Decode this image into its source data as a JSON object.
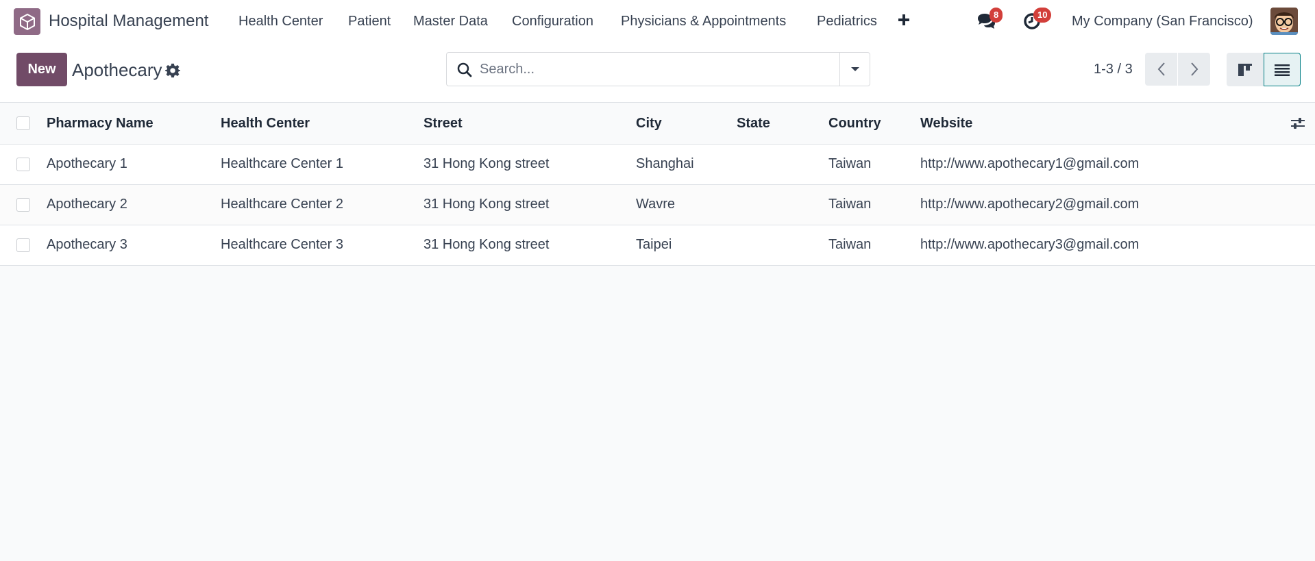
{
  "navbar": {
    "app_title": "Hospital Management",
    "menu": [
      "Health Center",
      "Patient",
      "Master Data",
      "Configuration",
      "Physicians & Appointments",
      "Pediatrics"
    ],
    "messages_count": "8",
    "activities_count": "10",
    "company": "My Company (San Francisco)",
    "icons": {
      "logo": "app-cube-icon",
      "add": "plus-icon",
      "messages": "chat-icon",
      "activities": "clock-icon"
    },
    "colors": {
      "brand": "#714b67",
      "badge": "#d23f3a"
    }
  },
  "control_panel": {
    "new_label": "New",
    "title": "Apothecary",
    "search_placeholder": "Search...",
    "pager": "1-3 / 3"
  },
  "table": {
    "columns": [
      "Pharmacy Name",
      "Health Center",
      "Street",
      "City",
      "State",
      "Country",
      "Website"
    ],
    "rows": [
      [
        "Apothecary 1",
        "Healthcare Center 1",
        "31 Hong Kong street",
        "Shanghai",
        "",
        "Taiwan",
        "http://www.apothecary1@gmail.com"
      ],
      [
        "Apothecary 2",
        "Healthcare Center 2",
        "31 Hong Kong street",
        "Wavre",
        "",
        "Taiwan",
        "http://www.apothecary2@gmail.com"
      ],
      [
        "Apothecary 3",
        "Healthcare Center 3",
        "31 Hong Kong street",
        "Taipei",
        "",
        "Taiwan",
        "http://www.apothecary3@gmail.com"
      ]
    ]
  }
}
